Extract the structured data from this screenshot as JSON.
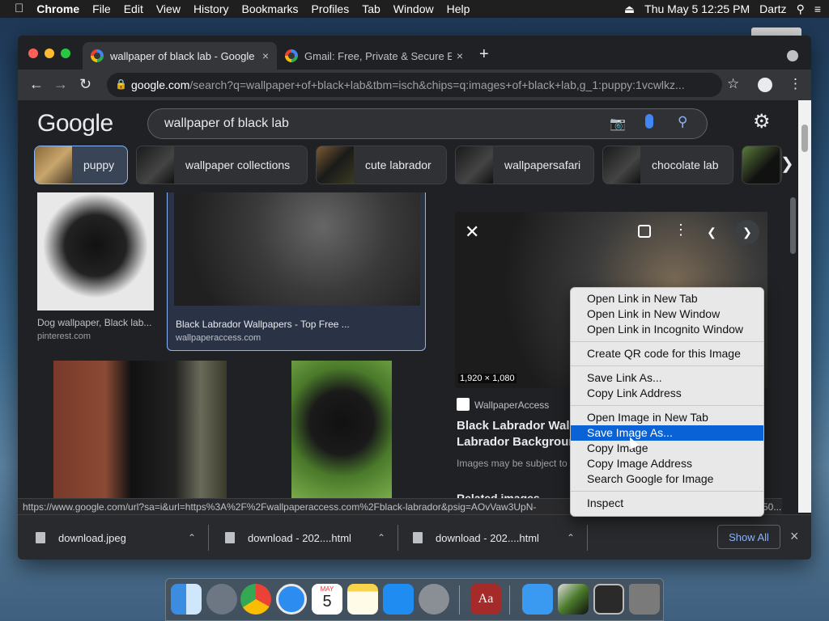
{
  "menubar": {
    "app": "Chrome",
    "items": [
      "File",
      "Edit",
      "View",
      "History",
      "Bookmarks",
      "Profiles",
      "Tab",
      "Window",
      "Help"
    ],
    "datetime": "Thu May 5  12:25 PM",
    "user": "Dartz"
  },
  "tabs": [
    {
      "title": "wallpaper of black lab - Google",
      "close": "×"
    },
    {
      "title": "Gmail: Free, Private & Secure E",
      "close": "×"
    }
  ],
  "new_tab": "+",
  "address": {
    "domain": "google.com",
    "path": "/search?q=wallpaper+of+black+lab&tbm=isch&chips=q:images+of+black+lab,g_1:puppy:1vcwlkz..."
  },
  "google": {
    "logo": "Google",
    "query": "wallpaper of black lab",
    "chips": [
      "puppy",
      "wallpaper collections",
      "cute labrador",
      "wallpapersafari",
      "chocolate lab"
    ]
  },
  "results": [
    {
      "caption": "Dog wallpaper, Black lab...",
      "source": "pinterest.com"
    },
    {
      "caption": "Black Labrador Wallpapers - Top Free ...",
      "source": "wallpaperaccess.com"
    }
  ],
  "side_panel": {
    "dimensions": "1,920 × 1,080",
    "site": "WallpaperAccess",
    "title_line1": "Black Labrador Wallp",
    "title_line2": "Labrador Background",
    "notice": "Images may be subject to",
    "related": "Related images"
  },
  "status_url": "https://www.google.com/url?sa=i&url=https%3A%2F%2Fwallpaperaccess.com%2Fblack-labrador&psig=AOvVaw3UpN-",
  "status_tail": "50...",
  "context_menu": {
    "groups": [
      [
        "Open Link in New Tab",
        "Open Link in New Window",
        "Open Link in Incognito Window"
      ],
      [
        "Create QR code for this Image"
      ],
      [
        "Save Link As...",
        "Copy Link Address"
      ],
      [
        "Open Image in New Tab",
        "Save Image As...",
        "Copy Image",
        "Copy Image Address",
        "Search Google for Image"
      ],
      [
        "Inspect"
      ]
    ],
    "highlighted": "Save Image As..."
  },
  "downloads": {
    "items": [
      "download.jpeg",
      "download - 202....html",
      "download - 202....html"
    ],
    "show_all": "Show All",
    "close": "×"
  },
  "dock": {
    "calendar_month": "MAY",
    "calendar_day": "5"
  }
}
